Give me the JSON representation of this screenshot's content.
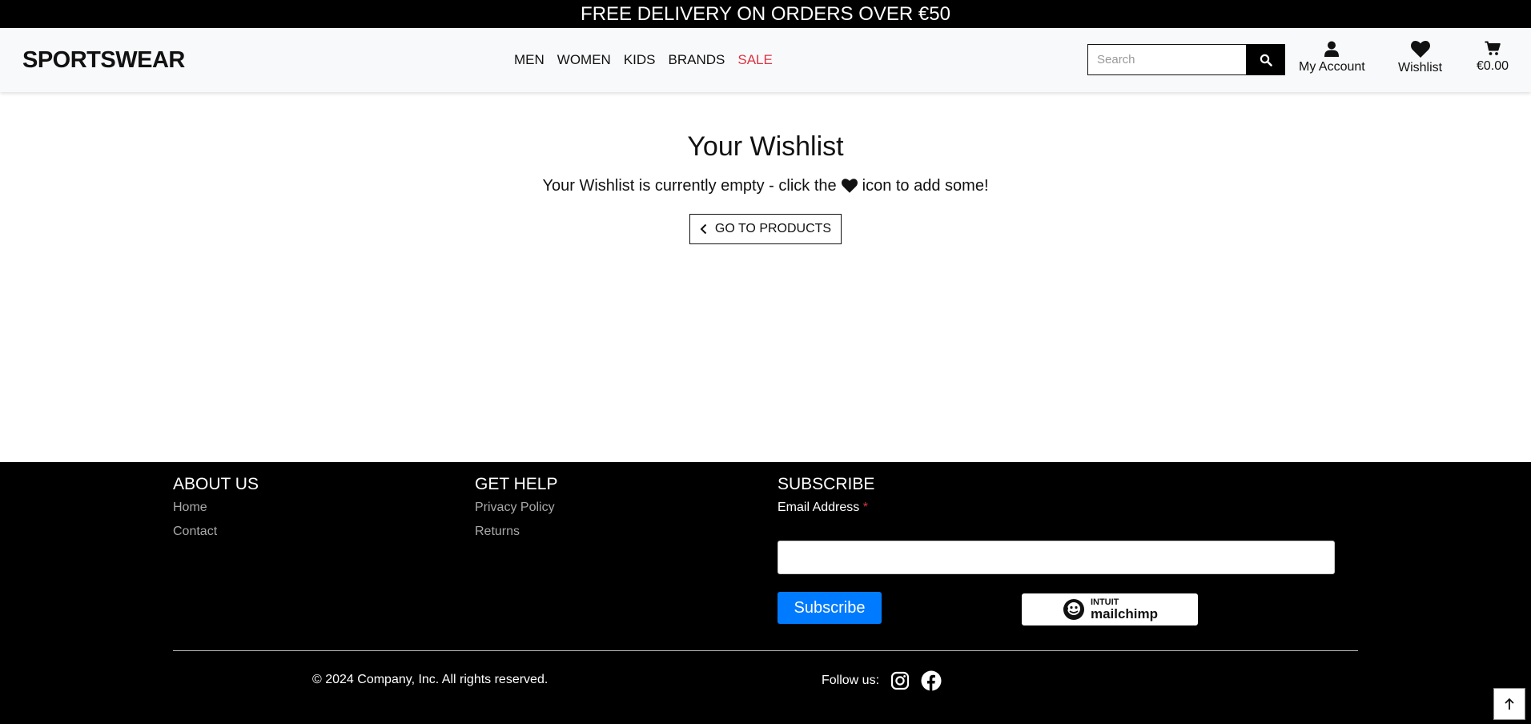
{
  "topbar": {
    "text": "FREE DELIVERY ON ORDERS OVER €50"
  },
  "header": {
    "logo": "SPORTSWEAR",
    "nav": [
      "MEN",
      "WOMEN",
      "KIDS",
      "BRANDS",
      "SALE"
    ],
    "search_placeholder": "Search",
    "account_label": "My Account",
    "wishlist_label": "Wishlist",
    "cart_total": "€0.00"
  },
  "main": {
    "title": "Your Wishlist",
    "empty_before": "Your Wishlist is currently empty - click the",
    "empty_after": "icon to add some!",
    "button_label": "GO TO PRODUCTS"
  },
  "footer": {
    "about": {
      "heading": "ABOUT US",
      "links": [
        "Home",
        "Contact"
      ]
    },
    "help": {
      "heading": "GET HELP",
      "links": [
        "Privacy Policy",
        "Returns"
      ]
    },
    "subscribe": {
      "heading": "SUBSCRIBE",
      "email_label": "Email Address",
      "required_mark": "*",
      "button": "Subscribe",
      "badge_top": "INTUIT",
      "badge_bottom": "mailchimp"
    },
    "copyright": "© 2024 Company, Inc. All rights reserved.",
    "follow": "Follow us:"
  },
  "colors": {
    "sale": "#dc3545",
    "subscribe": "#007bff",
    "footer_bg": "#000000"
  },
  "icons": [
    "search-icon",
    "user-icon",
    "heart-icon",
    "cart-icon",
    "chevron-left-icon",
    "instagram-icon",
    "facebook-icon",
    "arrow-up-icon",
    "mailchimp-icon"
  ]
}
